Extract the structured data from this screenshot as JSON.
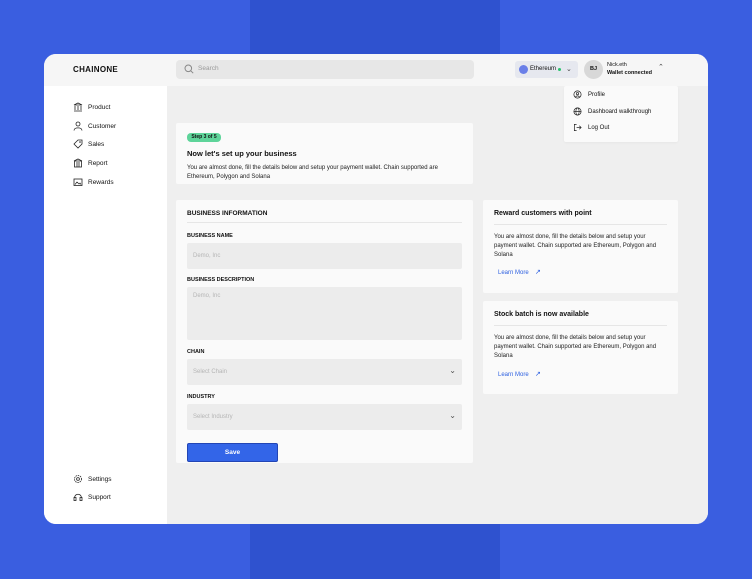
{
  "app": {
    "logo": "CHAINONE"
  },
  "search": {
    "placeholder": "Search",
    "icon": "search-icon"
  },
  "network": {
    "label": "Ethereum",
    "status_color": "#27c26c"
  },
  "user": {
    "initials": "BJ",
    "name": "Nick.eth",
    "status": "Wallet connected"
  },
  "user_menu": {
    "items": [
      {
        "label": "Profile",
        "icon": "user-circle-icon"
      },
      {
        "label": "Dashboard walkthrough",
        "icon": "globe-icon"
      },
      {
        "label": "Log Out",
        "icon": "logout-icon"
      }
    ]
  },
  "sidebar": {
    "items": [
      {
        "label": "Product",
        "icon": "bank-icon"
      },
      {
        "label": "Customer",
        "icon": "user-icon"
      },
      {
        "label": "Sales",
        "icon": "tag-icon"
      },
      {
        "label": "Report",
        "icon": "building-icon"
      },
      {
        "label": "Rewards",
        "icon": "image-icon"
      }
    ],
    "bottom_items": [
      {
        "label": "Settings",
        "icon": "gear-icon"
      },
      {
        "label": "Support",
        "icon": "headset-icon"
      }
    ]
  },
  "step": {
    "badge": "Step 3 of 5",
    "title": "Now let's set up your  business",
    "description": "You are almost done, fill the details below  and setup your payment wallet. Chain supported are Ethereum, Polygon and Solana"
  },
  "form": {
    "heading": "BUSINESS INFORMATION",
    "business_name": {
      "label": "BUSINESS NAME",
      "placeholder": "Demo, Inc"
    },
    "business_description": {
      "label": "BUSINESS DESCRIPTION",
      "placeholder": "Demo, Inc"
    },
    "chain": {
      "label": "CHAIN",
      "placeholder": "Select Chain"
    },
    "industry": {
      "label": "INDUSTRY",
      "placeholder": "Select Industry"
    },
    "save_label": "Save"
  },
  "cards": [
    {
      "title": "Reward customers with point",
      "description": "You are almost done, fill the details below  and setup your payment wallet. Chain supported are Ethereum, Polygon and Solana",
      "link": "Learn More"
    },
    {
      "title": "Stock batch is now available",
      "description": "You are almost done, fill the details below  and setup your payment wallet. Chain supported are Ethereum, Polygon and Solana",
      "link": "Learn More"
    }
  ],
  "colors": {
    "background": "#3357d6",
    "accent": "#3365e8",
    "badge": "#5ed49a",
    "link": "#2c5fe0"
  }
}
